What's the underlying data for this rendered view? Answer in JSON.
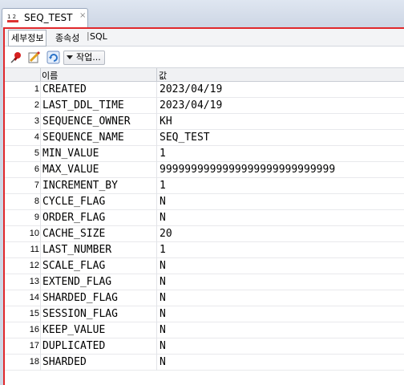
{
  "document_tab": {
    "title": "SEQ_TEST",
    "close": "×",
    "icon": "sequence-icon"
  },
  "subtabs": [
    {
      "label": "세부정보",
      "active": true
    },
    {
      "label": "종속성",
      "active": false
    },
    {
      "label": "SQL",
      "active": false
    }
  ],
  "subtab_separator": "|",
  "toolbar": {
    "actions_label": "작업...",
    "icons": [
      "pin-icon",
      "edit-icon",
      "refresh-icon"
    ]
  },
  "grid": {
    "columns": [
      "이름",
      "값"
    ],
    "rows": [
      {
        "num": "1",
        "name": "CREATED",
        "value": "2023/04/19"
      },
      {
        "num": "2",
        "name": "LAST_DDL_TIME",
        "value": "2023/04/19"
      },
      {
        "num": "3",
        "name": "SEQUENCE_OWNER",
        "value": "KH"
      },
      {
        "num": "4",
        "name": "SEQUENCE_NAME",
        "value": "SEQ_TEST"
      },
      {
        "num": "5",
        "name": "MIN_VALUE",
        "value": "1"
      },
      {
        "num": "6",
        "name": "MAX_VALUE",
        "value": "9999999999999999999999999999"
      },
      {
        "num": "7",
        "name": "INCREMENT_BY",
        "value": "1"
      },
      {
        "num": "8",
        "name": "CYCLE_FLAG",
        "value": "N"
      },
      {
        "num": "9",
        "name": "ORDER_FLAG",
        "value": "N"
      },
      {
        "num": "10",
        "name": "CACHE_SIZE",
        "value": "20"
      },
      {
        "num": "11",
        "name": "LAST_NUMBER",
        "value": "1"
      },
      {
        "num": "12",
        "name": "SCALE_FLAG",
        "value": "N"
      },
      {
        "num": "13",
        "name": "EXTEND_FLAG",
        "value": "N"
      },
      {
        "num": "14",
        "name": "SHARDED_FLAG",
        "value": "N"
      },
      {
        "num": "15",
        "name": "SESSION_FLAG",
        "value": "N"
      },
      {
        "num": "16",
        "name": "KEEP_VALUE",
        "value": "N"
      },
      {
        "num": "17",
        "name": "DUPLICATED",
        "value": "N"
      },
      {
        "num": "18",
        "name": "SHARDED",
        "value": "N"
      }
    ]
  }
}
